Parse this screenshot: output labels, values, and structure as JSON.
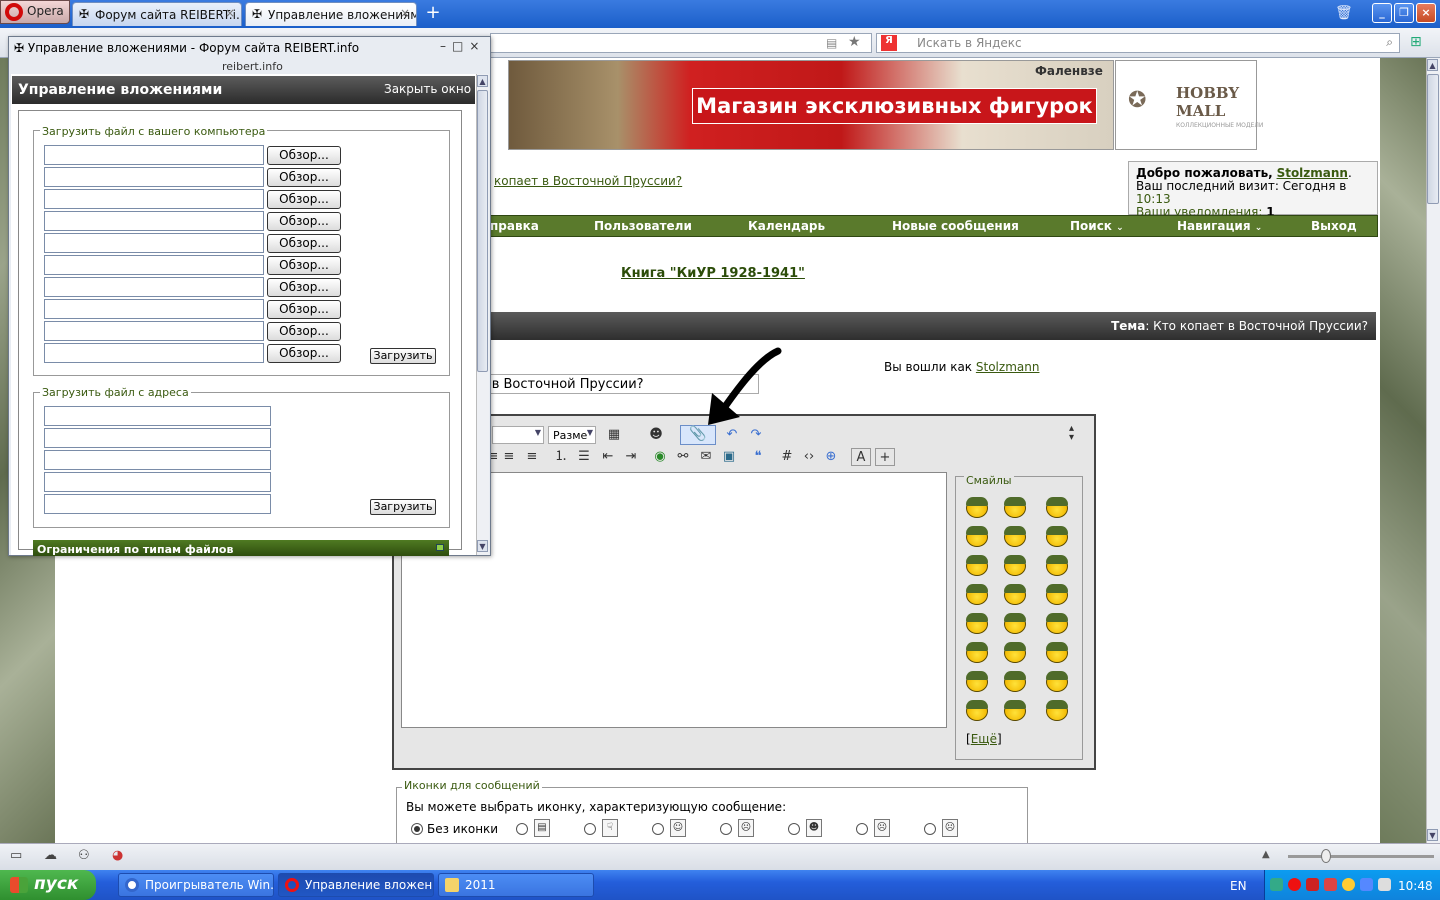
{
  "browser": {
    "opera_label": "Opera",
    "tabs": [
      {
        "label": "Форум сайта REIBERT.i..."
      },
      {
        "label": "Управление вложениям..."
      }
    ],
    "search_placeholder": "Искать в Яндекс",
    "yandex_letter": "Я"
  },
  "popup": {
    "title": "Управление вложениями - Форум сайта REIBERT.info",
    "domain": "reibert.info",
    "header": "Управление вложениями",
    "close_window": "Закрыть окно",
    "local_legend": "Загрузить файл с вашего компьютера",
    "browse_label": "Обзор...",
    "upload_label": "Загрузить",
    "url_legend": "Загрузить файл с адреса",
    "restrictions": "Ограничения по типам файлов",
    "file_inputs": 10,
    "url_inputs": 5
  },
  "page": {
    "banner_text": "Магазин эксклюзивных фигурок",
    "banner_sub": "Фаленвзе",
    "hobby_logo_1": "HOBBY",
    "hobby_logo_2": "MALL",
    "hobby_sub": "КОЛЛЕКЦИОННЫЕ МОДЕЛИ",
    "topic_link": "копает в Восточной Пруссии?",
    "welcome": {
      "greeting": "Добро пожаловать,",
      "user": "Stolzmann",
      "last_visit_label": "Ваш последний визит: Сегодня в",
      "last_visit_time": "10:13",
      "notifications_label": "Ваши уведомления:",
      "notifications_count": "1"
    },
    "nav": [
      "правка",
      "Пользователи",
      "Календарь",
      "Новые сообщения",
      "Поиск",
      "Навигация",
      "Выход"
    ],
    "book_link": "Книга \"КиУР 1928-1941\"",
    "theme_label": "Тема",
    "theme_value": ": Кто копает в Восточной Пруссии?",
    "logged_as_label": "Вы вошли как",
    "logged_as_user": "Stolzmann",
    "title_value": "т в Восточной Пруссии?",
    "size_label": "Разме",
    "smiles_legend": "Смайлы",
    "more_smiles": "Ещё",
    "icons_legend": "Иконки для сообщений",
    "icons_text": "Вы можете выбрать иконку, характеризующую сообщение:",
    "no_icon": "Без иконки"
  },
  "taskbar": {
    "start": "пуск",
    "items": [
      {
        "label": "Проигрыватель Win..."
      },
      {
        "label": "Управление вложен..."
      },
      {
        "label": "2011"
      }
    ],
    "lang": "EN",
    "clock": "10:48"
  },
  "colors": {
    "forum_green": "#5a7a2c",
    "link_green": "#3a5a10",
    "banner_red": "#c8161a"
  }
}
